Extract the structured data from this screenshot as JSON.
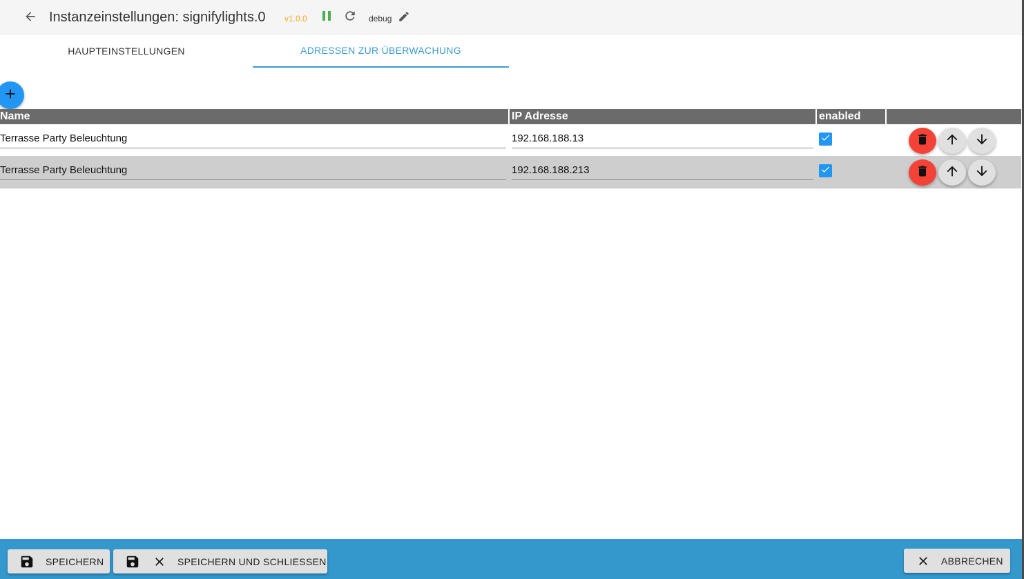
{
  "header": {
    "title": "Instanzeinstellungen: signifylights.0",
    "version": "v1.0.0",
    "loglevel": "debug",
    "colors": {
      "version": "#f5a623",
      "running": "#4caf50"
    }
  },
  "tabs": [
    {
      "label": "HAUPTEINSTELLUNGEN",
      "active": false
    },
    {
      "label": "ADRESSEN ZUR ÜBERWACHUNG",
      "active": true
    }
  ],
  "table": {
    "columns": [
      "Name",
      "IP Adresse",
      "enabled"
    ],
    "rows": [
      {
        "name": "Terrasse Party Beleuchtung",
        "ip": "192.168.188.13",
        "enabled": true
      },
      {
        "name": "Terrasse Party Beleuchtung",
        "ip": "192.168.188.213",
        "enabled": true
      }
    ]
  },
  "footer": {
    "save_label": "SPEICHERN",
    "save_close_label": "SPEICHERN UND SCHLIESSEN",
    "cancel_label": "ABBRECHEN",
    "bar_color": "#3498cd"
  },
  "icons": [
    "arrow-left-icon",
    "pause-icon",
    "refresh-icon",
    "pencil-icon",
    "plus-icon",
    "check-icon",
    "trash-icon",
    "arrow-up-icon",
    "arrow-down-icon",
    "floppy-disk-icon",
    "close-icon"
  ]
}
